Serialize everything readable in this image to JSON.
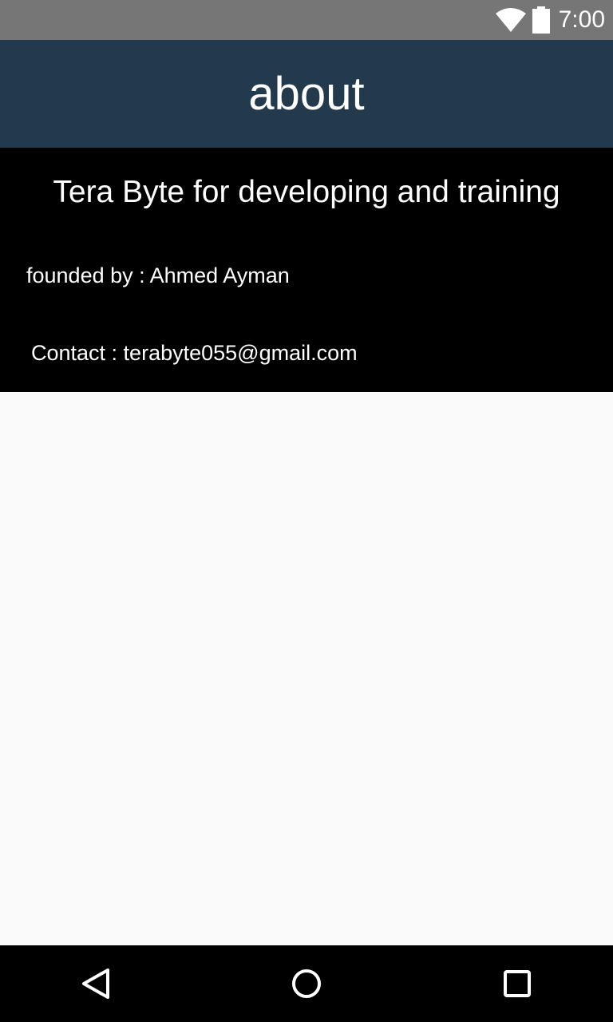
{
  "status_bar": {
    "time": "7:00",
    "icons": [
      "wifi-icon",
      "battery-icon"
    ]
  },
  "app_bar": {
    "title": "about"
  },
  "about": {
    "company": "Tera Byte for developing and training",
    "founder": "founded by : Ahmed Ayman",
    "contact": "Contact : terabyte055@gmail.com"
  },
  "nav_bar": {
    "buttons": [
      "back-icon",
      "home-icon",
      "recents-icon"
    ]
  },
  "colors": {
    "status_bar": "#767676",
    "app_bar": "#223a4b",
    "panel": "#000000",
    "background": "#fafafa",
    "text_light": "#ffffff"
  }
}
